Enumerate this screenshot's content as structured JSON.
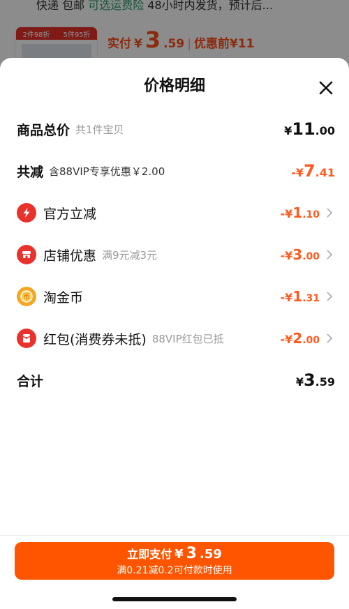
{
  "background": {
    "shipping_line_prefix": "快递 包邮 ",
    "shipping_line_green": "可选运费险",
    "shipping_line_suffix": " 48小时内发货，预计后...",
    "thumb_tags": [
      "2件98折",
      "5件95折"
    ],
    "price_label": "实付",
    "price_currency": "¥",
    "price_int": "3",
    "price_dec": ".59",
    "price_separator": "|",
    "before_discount": "优惠前¥11"
  },
  "sheet": {
    "title": "价格明细",
    "rows": [
      {
        "label": "商品总价",
        "note": "共1件宝贝",
        "sign": "¥",
        "int": "11",
        "dec": ".00",
        "color": "#111111"
      },
      {
        "label": "共减",
        "note": "含88VIP专享优惠￥2.00",
        "sign": "-¥",
        "int": "7",
        "dec": ".41",
        "color": "#ff5a1f"
      },
      {
        "label": "官方立减",
        "note": "",
        "sign": "-¥",
        "int": "1",
        "dec": ".10",
        "color": "#ff5a1f",
        "icon": "lightning-icon"
      },
      {
        "label": "店铺优惠",
        "note": "满9元减3元",
        "sign": "-¥",
        "int": "3",
        "dec": ".00",
        "color": "#ff5a1f",
        "icon": "shop-icon"
      },
      {
        "label": "淘金币",
        "note": "",
        "sign": "-¥",
        "int": "1",
        "dec": ".31",
        "color": "#ff5a1f",
        "icon": "coin-icon"
      },
      {
        "label": "红包(消费券未抵)",
        "note": "88VIP红包已抵",
        "sign": "-¥",
        "int": "2",
        "dec": ".00",
        "color": "#ff5a1f",
        "icon": "red-packet-icon"
      },
      {
        "label": "合计",
        "note": "",
        "sign": "¥",
        "int": "3",
        "dec": ".59",
        "color": "#111111"
      }
    ]
  },
  "pay": {
    "label": "立即支付",
    "currency": "¥",
    "int": "3",
    "dec": ".59",
    "subtext": "满0.21减0.2可付款时使用"
  },
  "colors": {
    "accent": "#ff5500",
    "discount": "#ff5a1f",
    "icon_red": "#e8322b",
    "coin": "#f5a623"
  }
}
